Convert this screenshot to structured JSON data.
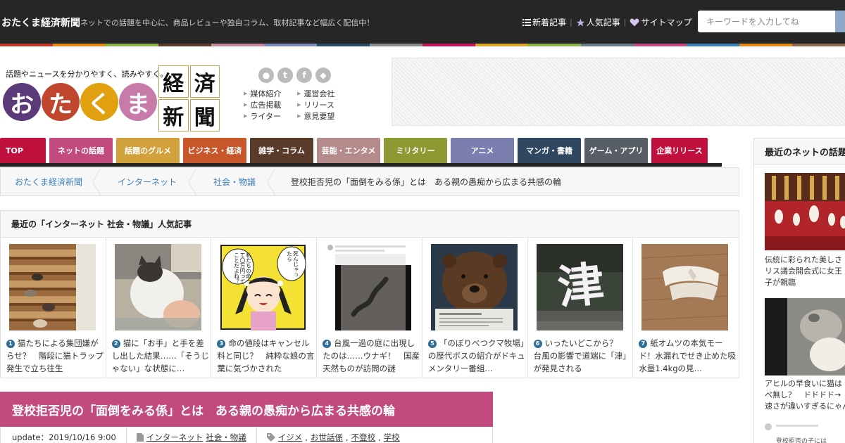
{
  "topbar": {
    "site_name": "おたくま経済新聞",
    "tagline": "ネットでの話題を中心に、商品レビューや独自コラム、取材記事など幅広く配信中！",
    "links": [
      {
        "icon": "list-icon",
        "label": "新着記事"
      },
      {
        "icon": "star-icon",
        "label": "人気記事"
      },
      {
        "icon": "heart-icon",
        "label": "サイトマップ"
      }
    ],
    "search_placeholder": "キーワードを入力してね",
    "strip_colors": [
      "#c0392b",
      "#e08a1e",
      "#8ab34a",
      "#5a3a2a",
      "#c48a9a",
      "#7a8ab8",
      "#2c4a66",
      "#8a8a8a",
      "#c2185b",
      "#d8a82e",
      "#8ab34a",
      "#6a7a8a",
      "#c34a7e",
      "#3b7fb8",
      "#e08a1e",
      "#8b6b4a"
    ]
  },
  "header": {
    "catch": "話題やニュースを分かりやすく、読みやすく。",
    "logo_kana": [
      {
        "char": "お",
        "color": "#5b3a7a"
      },
      {
        "char": "た",
        "color": "#c0472e"
      },
      {
        "char": "く",
        "color": "#e0a010"
      },
      {
        "char": "ま",
        "color": "#c87ba8"
      }
    ],
    "logo_kanji": [
      "経",
      "済",
      "新",
      "聞"
    ],
    "social": [
      "rss-icon",
      "twitter-icon",
      "facebook-icon",
      "feedly-icon"
    ],
    "links": [
      "媒体紹介",
      "運営会社",
      "広告掲載",
      "リリース",
      "ライター",
      "意見要望"
    ]
  },
  "nav": [
    {
      "label": "TOP",
      "color": "#c2103e",
      "w": 65
    },
    {
      "label": "ネットの話題",
      "color": "#c34a7e",
      "w": 90
    },
    {
      "label": "話題のグルメ",
      "color": "#d3a13b",
      "w": 90
    },
    {
      "label": "ビジネス・経済",
      "color": "#c7562a",
      "w": 90
    },
    {
      "label": "雑学・コラム",
      "color": "#5a3b2a",
      "w": 90
    },
    {
      "label": "芸能・エンタメ",
      "color": "#b58a8a",
      "w": 90
    },
    {
      "label": "ミリタリー",
      "color": "#8d9a34",
      "w": 90
    },
    {
      "label": "アニメ",
      "color": "#7a7fb0",
      "w": 90
    },
    {
      "label": "マンガ・書籍",
      "color": "#2f4760",
      "w": 90
    },
    {
      "label": "ゲーム・アプリ",
      "color": "#585e66",
      "w": 90
    },
    {
      "label": "企業リリース",
      "color": "#c2103e",
      "w": 80
    }
  ],
  "breadcrumb": {
    "items": [
      "おたくま経済新聞",
      "インターネット",
      "社会・物議"
    ],
    "current": "登校拒否児の「面倒をみる係」とは　ある親の愚痴から広まる共感の輪"
  },
  "popular": {
    "title": "最近の「インターネット 社会・物議」人気記事",
    "items": [
      {
        "rank": "1",
        "text": "猫たちによる集団嫌がらせ？　階段に猫トラップ発生で立ち往生"
      },
      {
        "rank": "2",
        "text": "猫に「お手」と手を差し出した結果……「そうじゃない」な状態に…"
      },
      {
        "rank": "3",
        "text": "命の値段はキャンセル料と同じ？　純粋な娘の言葉に気づかされた"
      },
      {
        "rank": "4",
        "text": "台風一過の庭に出現したのは……ウナギ！　国産天然ものが訪問の謎"
      },
      {
        "rank": "5",
        "text": "「のぼりべつクマ牧場」の歴代ボスの紹介がドキュメンタリー番組…"
      },
      {
        "rank": "6",
        "text": "いったいどこから？　台風の影響で道端に「津」が発見される"
      },
      {
        "rank": "7",
        "text": "紙オムツの本気モード！水漏れでせき止めた吸水量1.4kgの見…"
      }
    ],
    "manga_lines": [
      "死んじゃったら",
      "私たちの命って",
      "〇万円ってことだよね？"
    ],
    "kanji_sign": "津"
  },
  "article": {
    "title": "登校拒否児の「面倒をみる係」とは　ある親の愚痴から広まる共感の輪",
    "update_label": "update：2019/10/16 9:00",
    "categories": [
      "インターネット",
      "社会・物議"
    ],
    "tags": [
      "イジメ",
      "お世話係",
      "不登校",
      "学校"
    ]
  },
  "sidebar": {
    "title": "最近のネットの話題",
    "items": [
      {
        "text1": "伝統に彩られた美しさ",
        "text2": "リス議会開会式に女王",
        "text3": "子が親臨"
      },
      {
        "text1": "アヒルの早食いに猫は",
        "text2": "べ無し？　ドドドド→",
        "text3": "速さが違いすぎるにゃん"
      }
    ],
    "tweet_handle": "登校拒否の子には"
  }
}
